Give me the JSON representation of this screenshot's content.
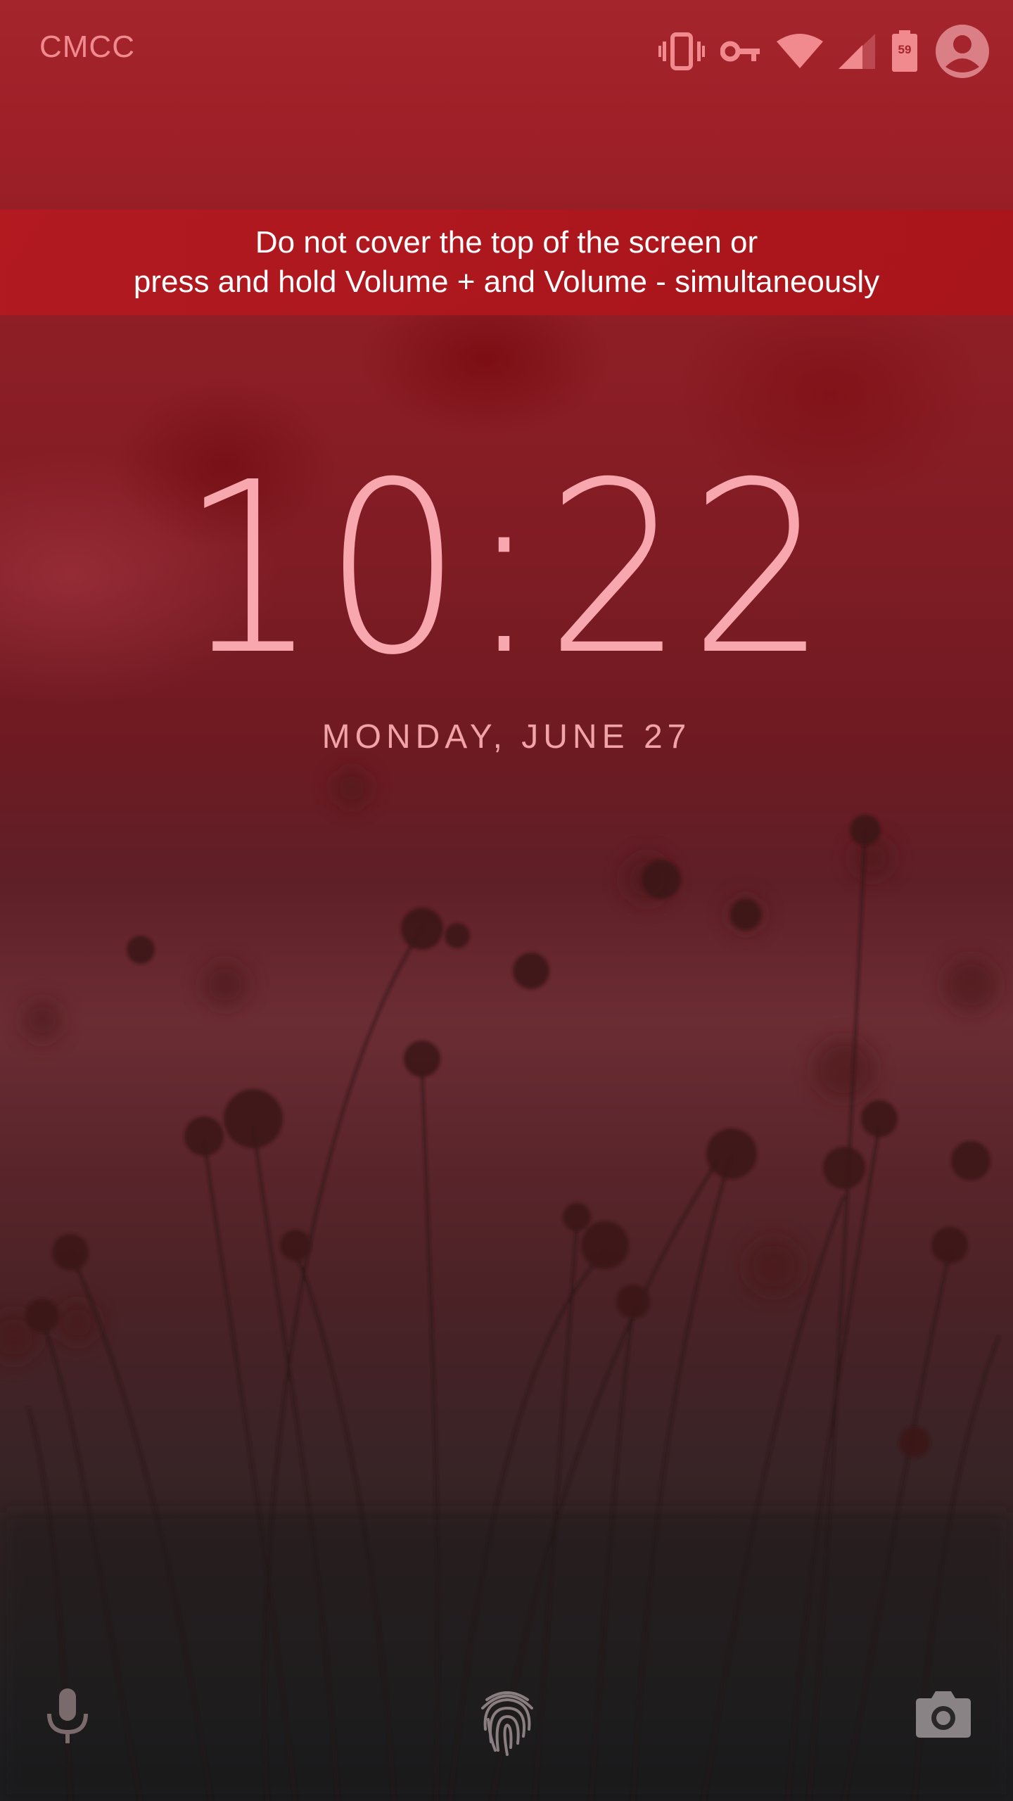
{
  "status_bar": {
    "carrier": "CMCC",
    "icons": [
      "vibrate-icon",
      "vpn-key-icon",
      "wifi-icon",
      "cell-signal-icon",
      "battery-icon",
      "user-avatar-icon"
    ],
    "battery_level": "59"
  },
  "banner": {
    "line1": "Do not cover the top of the screen or",
    "line2": "press and hold Volume + and Volume - simultaneously"
  },
  "clock": {
    "time": "10:22"
  },
  "date": {
    "text": "MONDAY, JUNE 27"
  },
  "bottom_bar": {
    "left_icon": "microphone-icon",
    "center_icon": "fingerprint-icon",
    "right_icon": "camera-icon"
  },
  "colors": {
    "accent_red": "#a5252c",
    "clock_pink": "#f7a7ad",
    "banner_red": "#b4191f",
    "icon_pink": "#f08a8f"
  }
}
